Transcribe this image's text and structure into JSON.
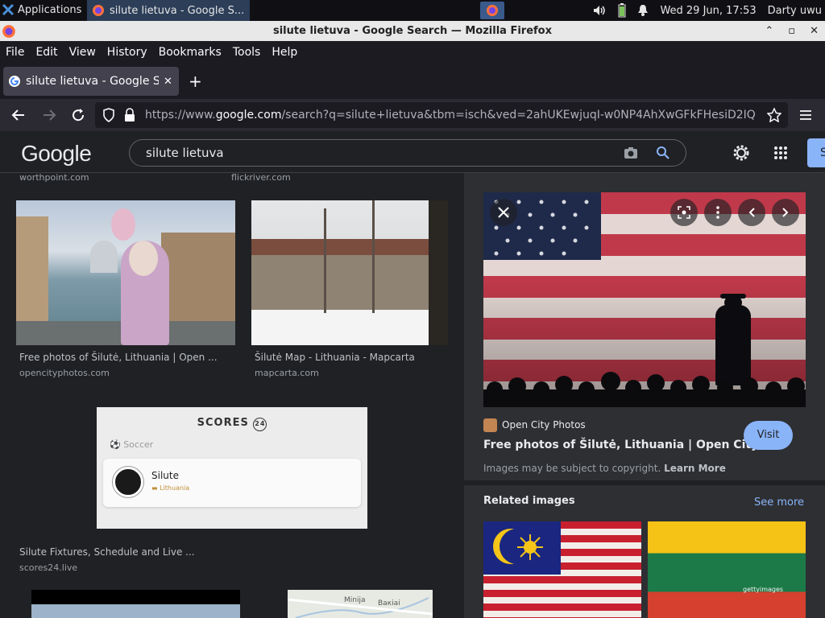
{
  "taskbar": {
    "applications_label": "Applications",
    "active_task_title": "silute lietuva - Google S...",
    "datetime": "Wed 29 Jun, 17:53",
    "user": "Darty uwu"
  },
  "window": {
    "title": "silute lietuva - Google Search — Mozilla Firefox"
  },
  "menu": {
    "items": [
      "File",
      "Edit",
      "View",
      "History",
      "Bookmarks",
      "Tools",
      "Help"
    ]
  },
  "tab": {
    "title": "silute lietuva - Google Se"
  },
  "url": {
    "prefix": "https://www.",
    "domain": "google.com",
    "rest": "/search?q=silute+lietuva&tbm=isch&ved=2ahUKEwjuqI-w0NP4AhXwGFkFHesiD2IQ"
  },
  "google": {
    "logo": "Google",
    "query": "silute lietuva",
    "signin_letter": "S"
  },
  "results": {
    "top_sources": [
      "worthpoint.com",
      "flickriver.com"
    ],
    "items": [
      {
        "caption": "Free photos of Šilutė, Lithuania | Open ...",
        "source": "opencityphotos.com"
      },
      {
        "caption": "Šilutė Map - Lithuania - Mapcarta",
        "source": "mapcarta.com"
      },
      {
        "caption": "Silute Fixtures, Schedule and Live ...",
        "source": "scores24.live"
      }
    ],
    "scores_card": {
      "brand": "SCORES",
      "brand_num": "24",
      "sport": "Soccer",
      "team": "Silute",
      "country": "Lithuania"
    },
    "map_labels": [
      "Minija",
      "Вакіаі"
    ]
  },
  "panel": {
    "site_name": "Open City Photos",
    "title": "Free photos of Šilutė, Lithuania | Open City ...",
    "visit_label": "Visit",
    "copyright_text": "Images may be subject to copyright.",
    "learn_more": "Learn More",
    "related_label": "Related images",
    "see_more": "See more",
    "watermark": "gettyimages"
  },
  "colors": {
    "accent_blue": "#8ab4f8",
    "page_bg": "#202124",
    "panel_bg": "#2e2f33"
  }
}
